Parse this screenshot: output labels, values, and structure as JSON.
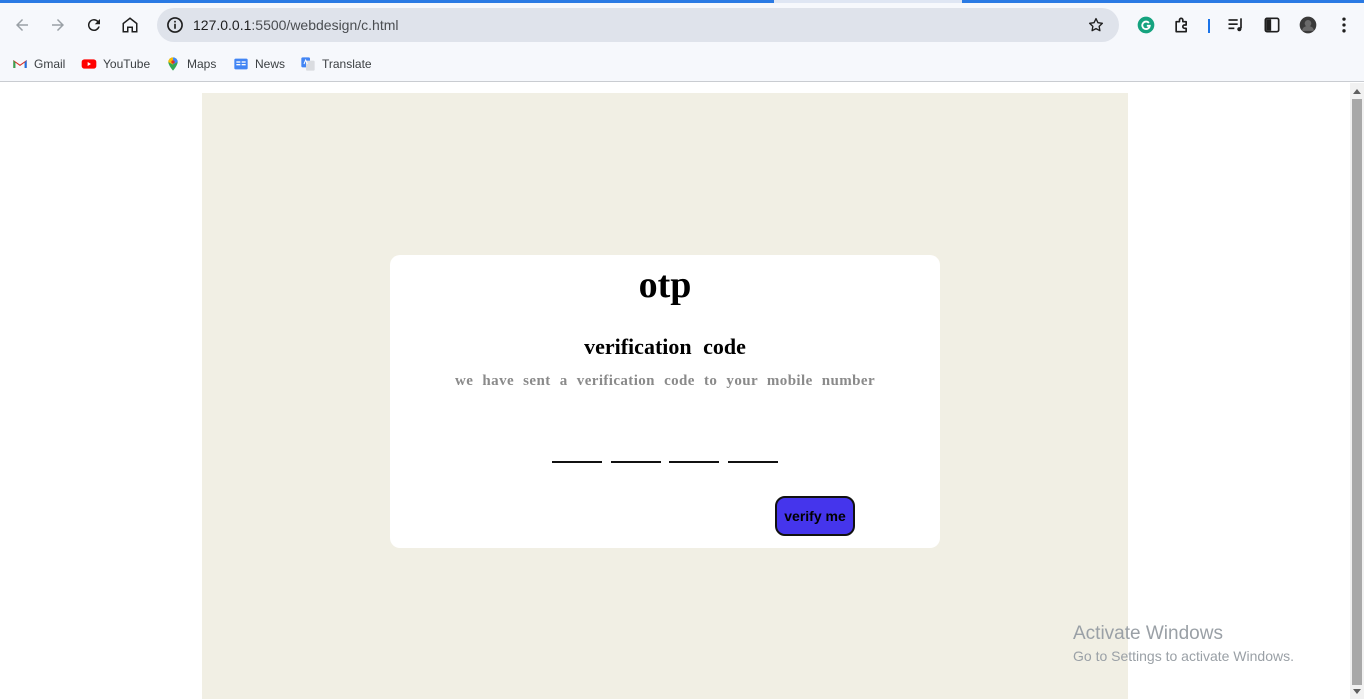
{
  "browser": {
    "url_host": "127.0.0.1",
    "url_rest": ":5500/webdesign/c.html",
    "bookmarks": [
      {
        "label": "Gmail",
        "icon": "gmail-icon"
      },
      {
        "label": "YouTube",
        "icon": "youtube-icon"
      },
      {
        "label": "Maps",
        "icon": "maps-icon"
      },
      {
        "label": "News",
        "icon": "news-icon"
      },
      {
        "label": "Translate",
        "icon": "translate-icon"
      }
    ]
  },
  "page": {
    "title": "otp",
    "subtitle": "verification  code",
    "hint": "we have sent a verification code to your mobile number",
    "otp_inputs": [
      "",
      "",
      "",
      ""
    ],
    "verify_label": "verify me",
    "colors": {
      "canvas_bg": "#f1efe4",
      "card_bg": "#ffffff",
      "button_bg": "#4535ec",
      "hint_text": "#8a8a8a"
    }
  },
  "watermark": {
    "line1": "Activate Windows",
    "line2": "Go to Settings to activate Windows."
  }
}
